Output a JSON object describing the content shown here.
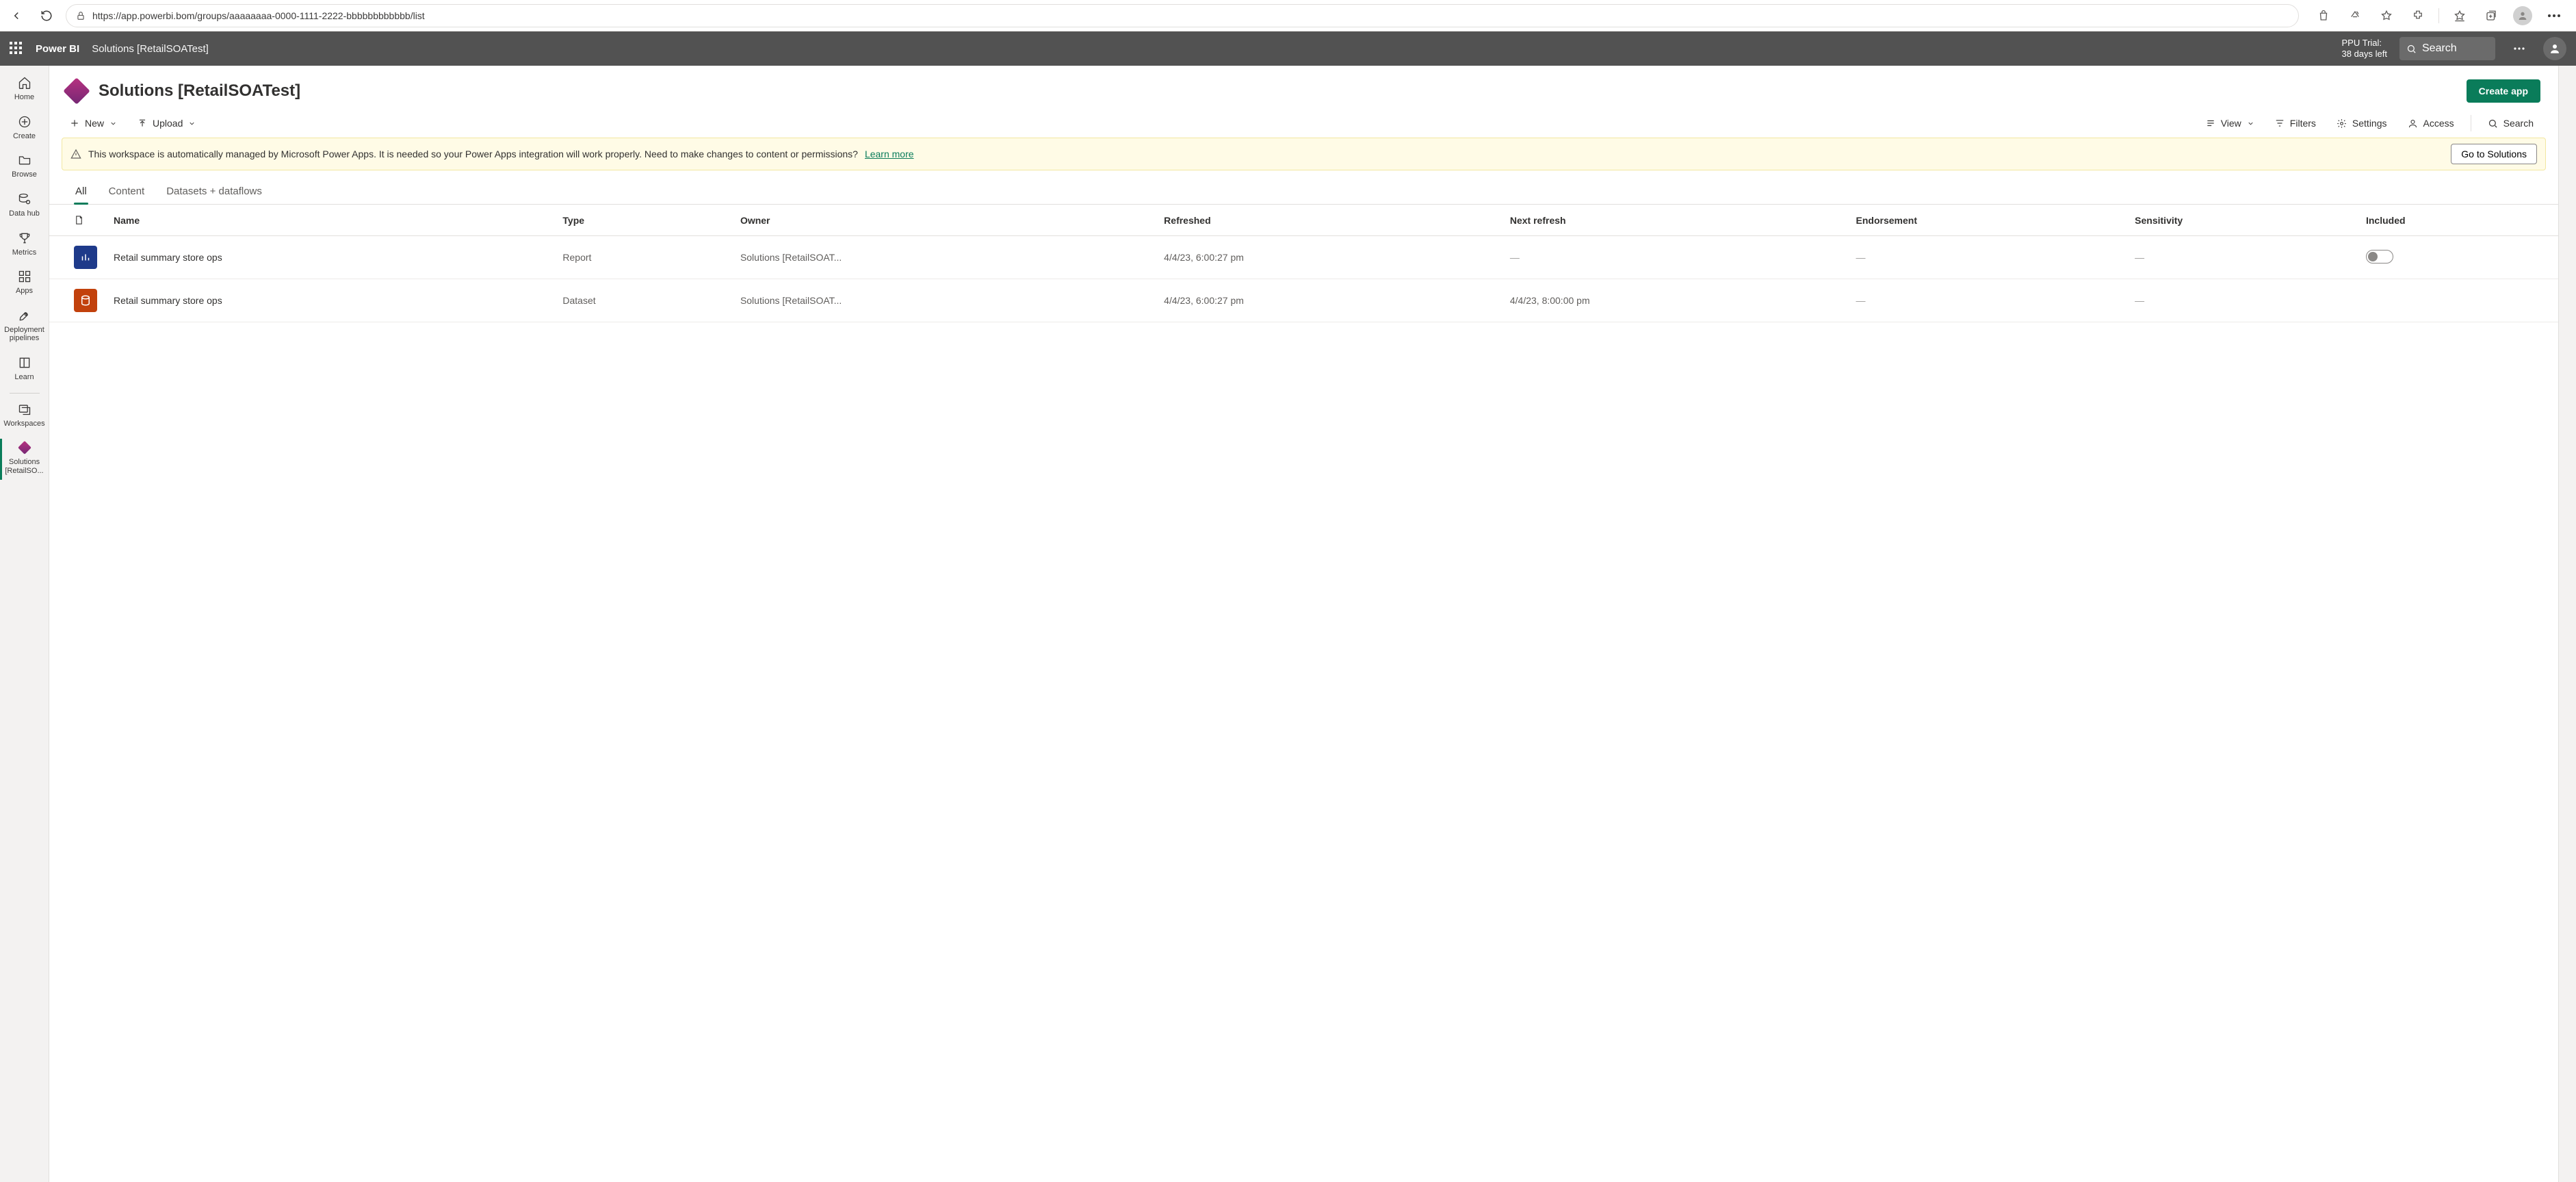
{
  "browser": {
    "url": "https://app.powerbi.bom/groups/aaaaaaaa-0000-1111-2222-bbbbbbbbbbbb/list"
  },
  "header": {
    "brand": "Power BI",
    "breadcrumb": "Solutions [RetailSOATest]",
    "trial_line1": "PPU Trial:",
    "trial_line2": "38 days left",
    "search_placeholder": "Search"
  },
  "nav": {
    "home": "Home",
    "create": "Create",
    "browse": "Browse",
    "datahub": "Data hub",
    "metrics": "Metrics",
    "apps": "Apps",
    "pipelines": "Deployment pipelines",
    "learn": "Learn",
    "workspaces": "Workspaces",
    "active_ws": "Solutions [RetailSO..."
  },
  "page": {
    "title": "Solutions [RetailSOATest]",
    "create_app": "Create app"
  },
  "commands": {
    "new": "New",
    "upload": "Upload",
    "view": "View",
    "filters": "Filters",
    "settings": "Settings",
    "access": "Access",
    "search": "Search"
  },
  "banner": {
    "text": "This workspace is automatically managed by Microsoft Power Apps. It is needed so your Power Apps integration will work properly. Need to make changes to content or permissions?",
    "link": "Learn more",
    "button": "Go to Solutions"
  },
  "tabs": {
    "all": "All",
    "content": "Content",
    "datasets": "Datasets + dataflows"
  },
  "columns": {
    "name": "Name",
    "type": "Type",
    "owner": "Owner",
    "refreshed": "Refreshed",
    "next": "Next refresh",
    "endorsement": "Endorsement",
    "sensitivity": "Sensitivity",
    "included": "Included"
  },
  "rows": [
    {
      "icon": "report",
      "name": "Retail summary store ops",
      "type": "Report",
      "owner": "Solutions [RetailSOAT...",
      "refreshed": "4/4/23, 6:00:27 pm",
      "next": "—",
      "endorsement": "—",
      "sensitivity": "—",
      "included_toggle": true
    },
    {
      "icon": "dataset",
      "name": "Retail summary store ops",
      "type": "Dataset",
      "owner": "Solutions [RetailSOAT...",
      "refreshed": "4/4/23, 6:00:27 pm",
      "next": "4/4/23, 8:00:00 pm",
      "endorsement": "—",
      "sensitivity": "—",
      "included_toggle": false
    }
  ]
}
